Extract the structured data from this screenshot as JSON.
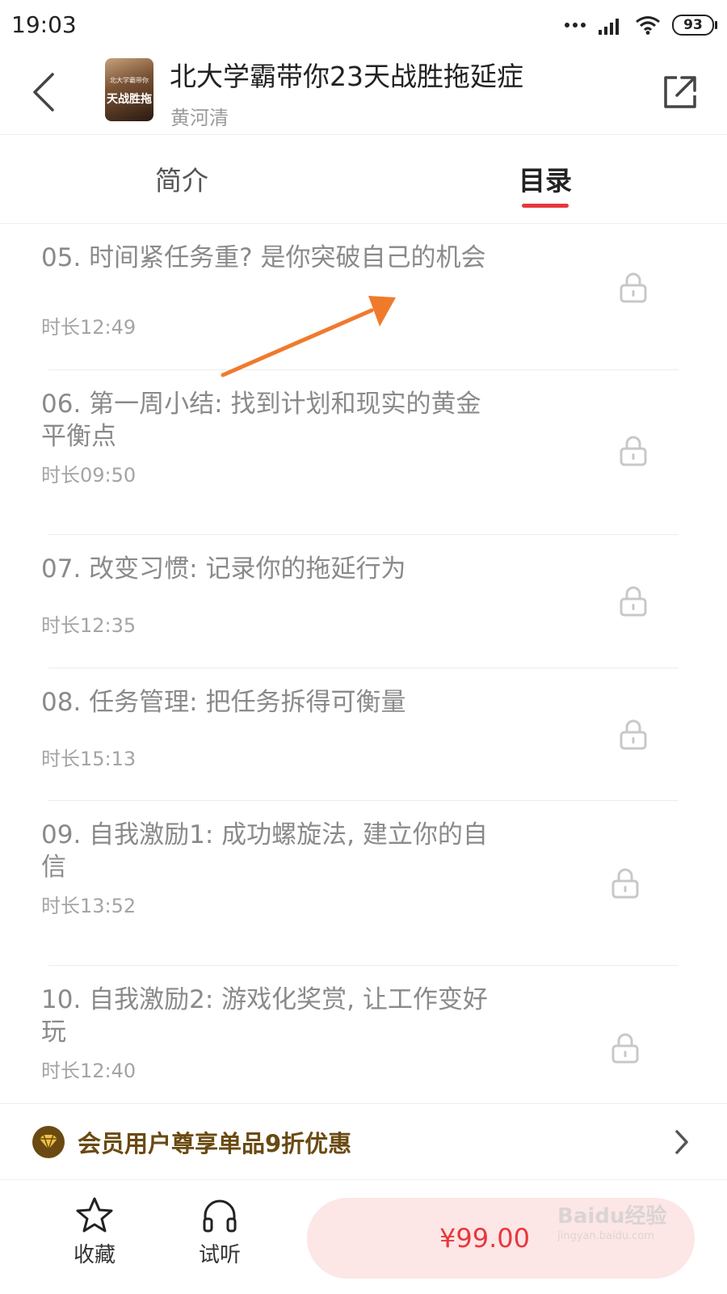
{
  "status_bar": {
    "time": "19:03",
    "battery": "93"
  },
  "header": {
    "cover_text_top": "北大学霸带你",
    "cover_text_main": "天战胜拖",
    "title": "北大学霸带你23天战胜拖延症",
    "author": "黄河清"
  },
  "tabs": [
    {
      "label": "简介",
      "active": false
    },
    {
      "label": "目录",
      "active": true
    }
  ],
  "episodes": [
    {
      "title": "05. 时间紧任务重? 是你突破自己的机会",
      "duration": "时长12:49",
      "locked": true
    },
    {
      "title": "06. 第一周小结: 找到计划和现实的黄金平衡点",
      "duration": "时长09:50",
      "locked": true
    },
    {
      "title": "07. 改变习惯: 记录你的拖延行为",
      "duration": "时长12:35",
      "locked": true
    },
    {
      "title": "08. 任务管理: 把任务拆得可衡量",
      "duration": "时长15:13",
      "locked": true
    },
    {
      "title": "09. 自我激励1: 成功螺旋法, 建立你的自信",
      "duration": "时长13:52",
      "locked": true
    },
    {
      "title": "10. 自我激励2: 游戏化奖赏, 让工作变好玩",
      "duration": "时长12:40",
      "locked": true
    }
  ],
  "member_banner": {
    "text": "会员用户尊享单品9折优惠"
  },
  "bottom_bar": {
    "favorite_label": "收藏",
    "listen_label": "试听",
    "price": "¥99.00"
  },
  "watermark": {
    "text": "Baidu经验",
    "sub": "jingyan.baidu.com"
  },
  "colors": {
    "accent": "#e8373d",
    "member": "#6a4a12",
    "arrow": "#f07a2c"
  }
}
